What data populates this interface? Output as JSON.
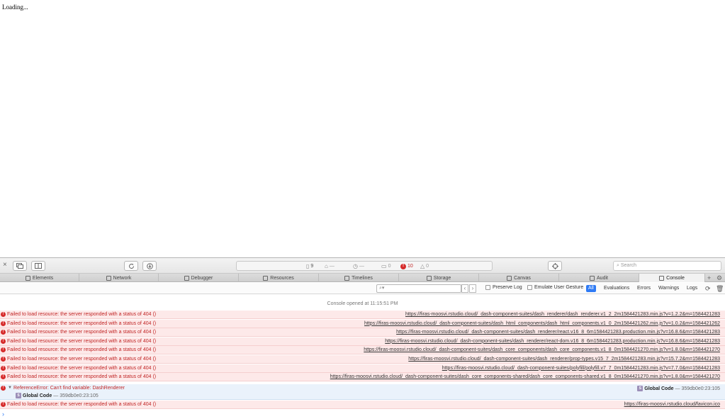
{
  "page": {
    "loading_text": "Loading..."
  },
  "toolbar": {
    "close_glyph": "×",
    "resources_count": "9",
    "transfer_size": "—",
    "load_time": "—",
    "logs_count": "0",
    "errors_count": "10",
    "warnings_count": "0",
    "search_placeholder": "Search"
  },
  "tabs": [
    {
      "label": "Elements",
      "icon": "elements-icon"
    },
    {
      "label": "Network",
      "icon": "network-icon"
    },
    {
      "label": "Debugger",
      "icon": "debugger-icon"
    },
    {
      "label": "Resources",
      "icon": "resources-icon"
    },
    {
      "label": "Timelines",
      "icon": "timelines-icon"
    },
    {
      "label": "Storage",
      "icon": "storage-icon"
    },
    {
      "label": "Canvas",
      "icon": "canvas-icon"
    },
    {
      "label": "Audit",
      "icon": "audit-icon"
    },
    {
      "label": "Console",
      "icon": "console-icon",
      "active": true
    }
  ],
  "filterbar": {
    "filter_placeholder": "",
    "preserve_log": "Preserve Log",
    "emulate_gesture": "Emulate User Gesture",
    "levels": [
      "All",
      "Evaluations",
      "Errors",
      "Warnings",
      "Logs"
    ],
    "selected_level": "All"
  },
  "console": {
    "opened_text": "Console opened at 11:15:51 PM",
    "messages": [
      {
        "text": "Failed to load resource: the server responded with a status of 404 ()",
        "url": "https://firas-moosvi.rstudio.cloud/_dash-component-suites/dash_renderer/dash_renderer.v1_2_2m1584421283.min.js?v=1.2.2&m=1584421283"
      },
      {
        "text": "Failed to load resource: the server responded with a status of 404 ()",
        "url": "https://firas-moosvi.rstudio.cloud/_dash-component-suites/dash_html_components/dash_html_components.v1_0_2m1584421262.min.js?v=1.0.2&m=1584421262"
      },
      {
        "text": "Failed to load resource: the server responded with a status of 404 ()",
        "url": "https://firas-moosvi.rstudio.cloud/_dash-component-suites/dash_renderer/react.v16_8_6m1584421283.production.min.js?v=16.8.6&m=1584421283"
      },
      {
        "text": "Failed to load resource: the server responded with a status of 404 ()",
        "url": "https://firas-moosvi.rstudio.cloud/_dash-component-suites/dash_renderer/react-dom.v16_8_6m1584421283.production.min.js?v=16.8.6&m=1584421283"
      },
      {
        "text": "Failed to load resource: the server responded with a status of 404 ()",
        "url": "https://firas-moosvi.rstudio.cloud/_dash-component-suites/dash_core_components/dash_core_components.v1_8_0m1584421270.min.js?v=1.8.0&m=1584421270"
      },
      {
        "text": "Failed to load resource: the server responded with a status of 404 ()",
        "url": "https://firas-moosvi.rstudio.cloud/_dash-component-suites/dash_renderer/prop-types.v15_7_2m1584421283.min.js?v=15.7.2&m=1584421283"
      },
      {
        "text": "Failed to load resource: the server responded with a status of 404 ()",
        "url": "https://firas-moosvi.rstudio.cloud/_dash-component-suites/polyfill/polyfill.v7_7_0m1584421283.min.js?v=7.7.0&m=1584421283"
      },
      {
        "text": "Failed to load resource: the server responded with a status of 404 ()",
        "url": "https://firas-moosvi.rstudio.cloud/_dash-component-suites/dash_core_components-shared/dash_core_components-shared.v1_8_0m1584421270.min.js?v=1.8.0&m=1584421270"
      }
    ],
    "exception": {
      "text": "ReferenceError: Can't find variable: DashRenderer",
      "badge": "S",
      "function": "Global Code",
      "separator": "—",
      "location": "359db0e0:23:105"
    },
    "last_message": {
      "text": "Failed to load resource: the server responded with a status of 404 ()",
      "url": "https://firas-moosvi.rstudio.cloud/favicon.ico"
    },
    "prompt_glyph": "›"
  },
  "colors": {
    "error": "#c12525",
    "error_bg": "#fde9e9",
    "accent": "#2f7bf5",
    "exception_bg": "#eaf2fb"
  }
}
